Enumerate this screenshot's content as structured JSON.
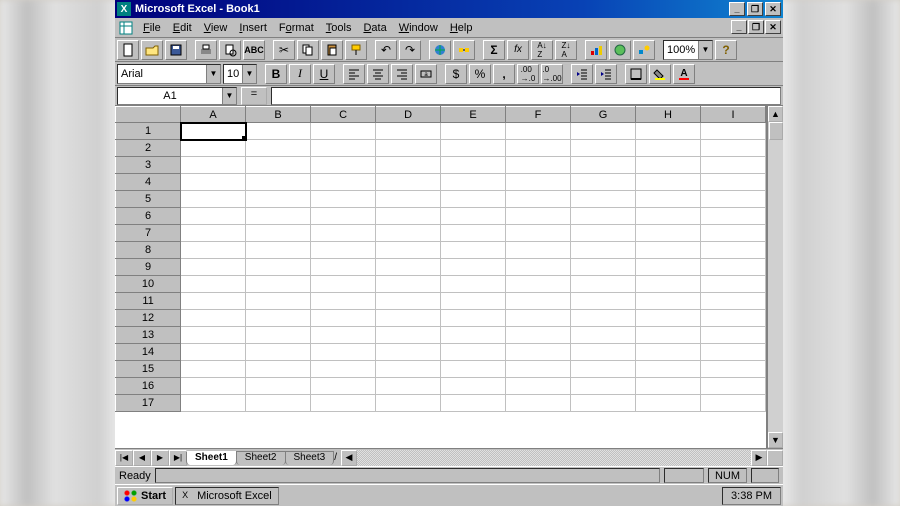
{
  "title": "Microsoft Excel - Book1",
  "menus": [
    "File",
    "Edit",
    "View",
    "Insert",
    "Format",
    "Tools",
    "Data",
    "Window",
    "Help"
  ],
  "toolbar1": {
    "new": "new-file-icon",
    "open": "open-icon",
    "save": "save-icon",
    "print": "print-icon",
    "preview": "preview-icon",
    "spell": "spell-icon",
    "cut": "cut-icon",
    "copy": "copy-icon",
    "paste": "paste-icon",
    "fmtpaint": "format-painter-icon",
    "undo": "undo-icon",
    "redo": "redo-icon",
    "link": "hyperlink-icon",
    "web": "web-toolbar-icon",
    "sum": "autosum-icon",
    "fx": "function-icon",
    "sortA": "sort-asc-icon",
    "sortZ": "sort-desc-icon",
    "chart": "chart-wizard-icon",
    "map": "map-icon",
    "draw": "drawing-icon",
    "zoom": "100%",
    "help": "help-icon"
  },
  "format": {
    "font": "Arial",
    "size": "10",
    "bold": "B",
    "italic": "I",
    "underline": "U",
    "alignL": "align-left-icon",
    "alignC": "align-center-icon",
    "alignR": "align-right-icon",
    "merge": "merge-center-icon",
    "currency": "$",
    "percent": "%",
    "comma": ",",
    "decInc": "dec-inc-icon",
    "decDec": "dec-dec-icon",
    "outdent": "outdent-icon",
    "indent": "indent-icon",
    "borders": "borders-icon",
    "fill": "fill-color-icon",
    "font_color": "font-color-icon"
  },
  "namebox": "A1",
  "formula": "",
  "columns": [
    "A",
    "B",
    "C",
    "D",
    "E",
    "F",
    "G",
    "H",
    "I"
  ],
  "rows": [
    1,
    2,
    3,
    4,
    5,
    6,
    7,
    8,
    9,
    10,
    11,
    12,
    13,
    14,
    15,
    16,
    17
  ],
  "activeCell": {
    "row": 1,
    "col": "A"
  },
  "sheets": [
    "Sheet1",
    "Sheet2",
    "Sheet3"
  ],
  "activeSheet": 0,
  "status": {
    "ready": "Ready",
    "num": "NUM"
  },
  "taskbar": {
    "start": "Start",
    "task": "Microsoft Excel",
    "clock": "3:38 PM"
  }
}
